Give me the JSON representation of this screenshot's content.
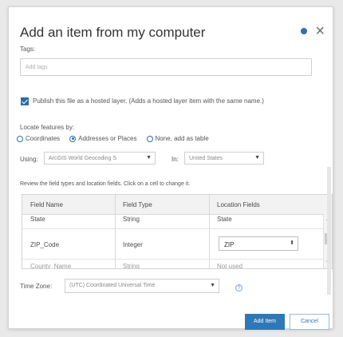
{
  "dialog": {
    "title": "Add an item from my computer",
    "tags_label": "Tags:",
    "tags_placeholder": "Add tags",
    "publish_text": "Publish this file as a hosted layer. (Adds a hosted layer item with the same name.)",
    "publish_checked": true,
    "locate_label": "Locate features by:",
    "locate_options": [
      {
        "label": "Coordinates",
        "selected": false
      },
      {
        "label": "Addresses or Places",
        "selected": true
      },
      {
        "label": "None, add as table",
        "selected": false
      }
    ],
    "using_label": "Using:",
    "using_value": "ArcGIS World Geocoding S",
    "in_label": "In:",
    "in_value": "United States",
    "review_text": "Review the field types and location fields. Click on a cell to change it.",
    "table": {
      "headers": [
        "Field Name",
        "Field Type",
        "Location Fields"
      ],
      "rows": [
        {
          "name": "State",
          "type": "String",
          "location": "State"
        },
        {
          "name": "ZIP_Code",
          "type": "Integer",
          "location": "ZIP"
        },
        {
          "name": "County_Name",
          "type": "String",
          "location": "Not used"
        }
      ]
    },
    "timezone_label": "Time Zone:",
    "timezone_value": "(UTC) Coordinated Universal Time",
    "help_glyph": "?",
    "add_button": "Add Item",
    "cancel_button": "Cancel"
  },
  "colors": {
    "accent": "#2f78b7",
    "checkbox": "#2d6ea6"
  },
  "icons": {
    "close": "close-icon",
    "info": "info-dot-icon"
  }
}
